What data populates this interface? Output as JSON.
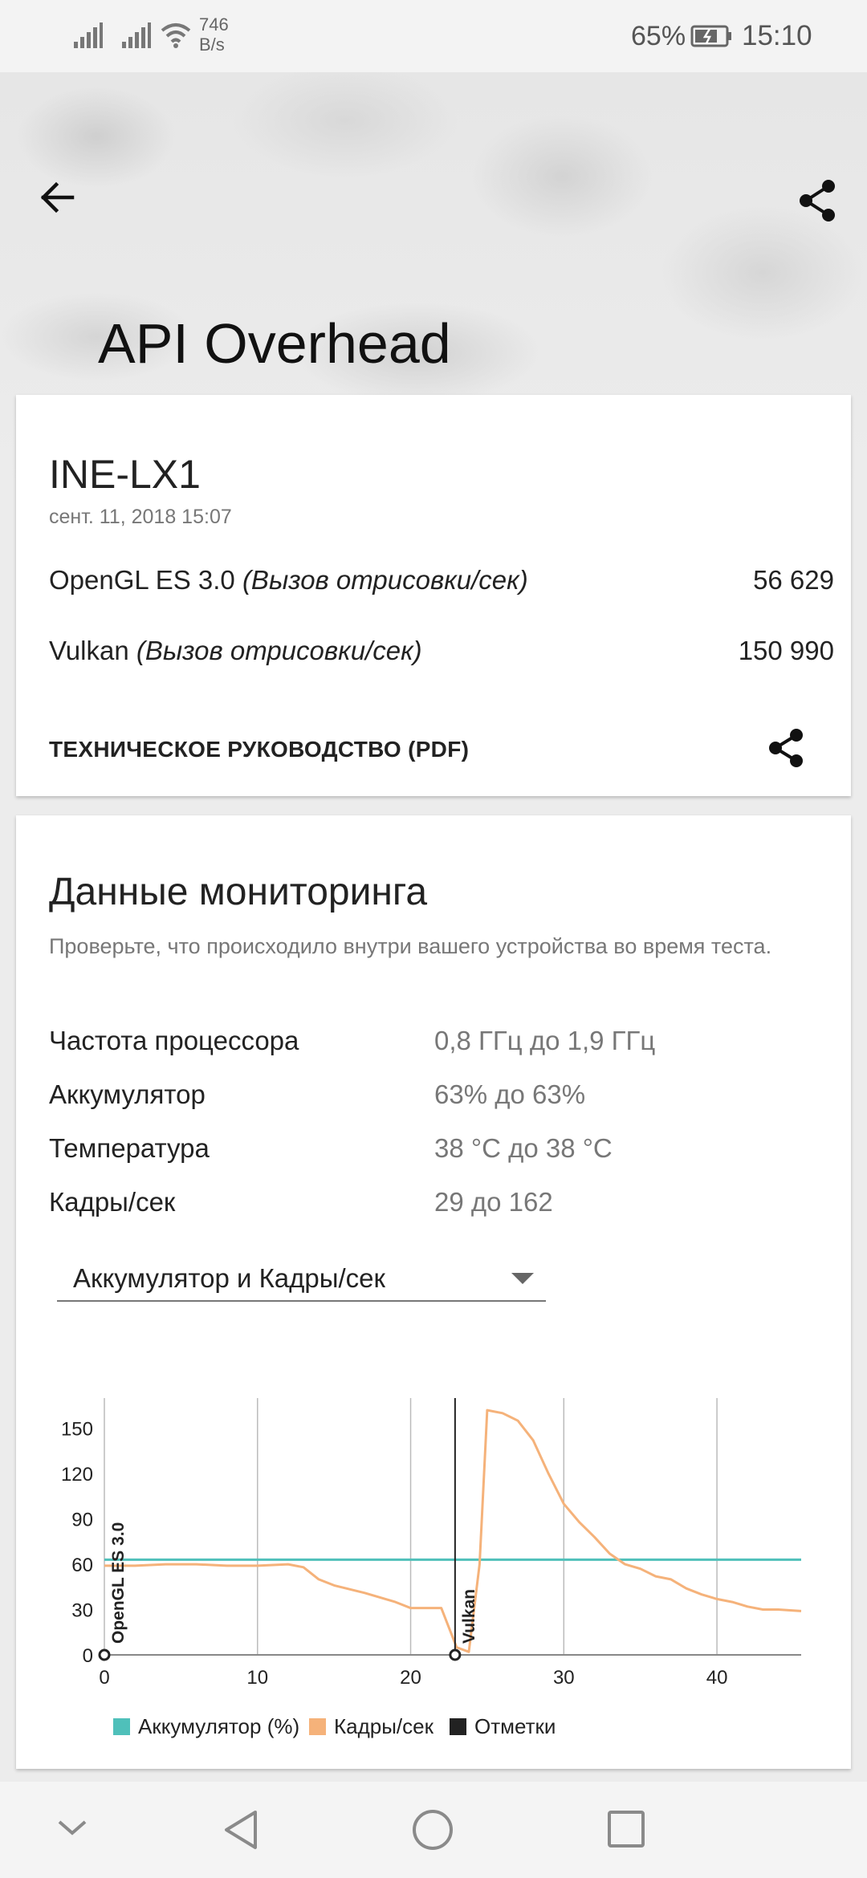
{
  "status_bar": {
    "speed_value": "746",
    "speed_unit": "B/s",
    "battery_percent": "65%",
    "time": "15:10"
  },
  "header": {
    "title": "API Overhead"
  },
  "result": {
    "device": "INE-LX1",
    "date": "сент. 11, 2018 15:07",
    "scores": [
      {
        "name": "OpenGL ES 3.0",
        "unit": "(Вызов отрисовки/сек)",
        "value": "56 629"
      },
      {
        "name": "Vulkan",
        "unit": "(Вызов отрисовки/сек)",
        "value": "150 990"
      }
    ],
    "tech_guide": "ТЕХНИЧЕСКОЕ РУКОВОДСТВО (PDF)"
  },
  "monitoring": {
    "title": "Данные мониторинга",
    "description": "Проверьте, что происходило внутри вашего устройства во время теста.",
    "rows": [
      {
        "label": "Частота процессора",
        "value": "0,8 ГГц до 1,9 ГГц"
      },
      {
        "label": "Аккумулятор",
        "value": "63% до 63%"
      },
      {
        "label": "Температура",
        "value": "38 °C до 38 °C"
      },
      {
        "label": "Кадры/сек",
        "value": "29 до 162"
      }
    ],
    "dropdown_selected": "Аккумулятор и Кадры/сек"
  },
  "chart_data": {
    "type": "line",
    "xlim": [
      0,
      45.5
    ],
    "ylim": [
      0,
      170
    ],
    "x_ticks": [
      0,
      10,
      20,
      30,
      40
    ],
    "y_ticks": [
      0,
      30,
      60,
      90,
      120,
      150
    ],
    "grid": "vertical",
    "series": [
      {
        "name": "Аккумулятор (%)",
        "color": "#4fc0ba",
        "points": [
          [
            0,
            63
          ],
          [
            45.5,
            63
          ]
        ]
      },
      {
        "name": "Кадры/сек",
        "color": "#f5b27a",
        "points": [
          [
            0,
            59
          ],
          [
            2,
            59
          ],
          [
            4,
            60
          ],
          [
            6,
            60
          ],
          [
            8,
            59
          ],
          [
            10,
            59
          ],
          [
            12,
            60
          ],
          [
            13,
            58
          ],
          [
            14,
            50
          ],
          [
            15,
            46
          ],
          [
            17,
            41
          ],
          [
            19,
            35
          ],
          [
            20,
            31
          ],
          [
            22,
            31
          ],
          [
            23,
            5
          ],
          [
            23.8,
            2
          ],
          [
            24.5,
            60
          ],
          [
            25,
            162
          ],
          [
            26,
            160
          ],
          [
            27,
            155
          ],
          [
            28,
            142
          ],
          [
            29,
            120
          ],
          [
            30,
            100
          ],
          [
            31,
            88
          ],
          [
            32,
            78
          ],
          [
            33,
            67
          ],
          [
            34,
            60
          ],
          [
            35,
            57
          ],
          [
            36,
            52
          ],
          [
            37,
            50
          ],
          [
            38,
            44
          ],
          [
            39,
            40
          ],
          [
            40,
            37
          ],
          [
            41,
            35
          ],
          [
            42,
            32
          ],
          [
            43,
            30
          ],
          [
            44,
            30
          ],
          [
            45.5,
            29
          ]
        ]
      }
    ],
    "markers": [
      {
        "x": 0,
        "label": "OpenGL ES 3.0"
      },
      {
        "x": 22.9,
        "label": "Vulkan"
      }
    ],
    "legend": {
      "position": "bottom",
      "items": [
        {
          "label": "Аккумулятор (%)",
          "color": "#4fc0ba"
        },
        {
          "label": "Кадры/сек",
          "color": "#f5b27a"
        },
        {
          "label": "Отметки",
          "color": "#222222"
        }
      ]
    }
  },
  "nav_bar": {
    "icons": [
      "chevron-down-icon",
      "back-triangle-icon",
      "home-circle-icon",
      "recents-square-icon"
    ]
  }
}
